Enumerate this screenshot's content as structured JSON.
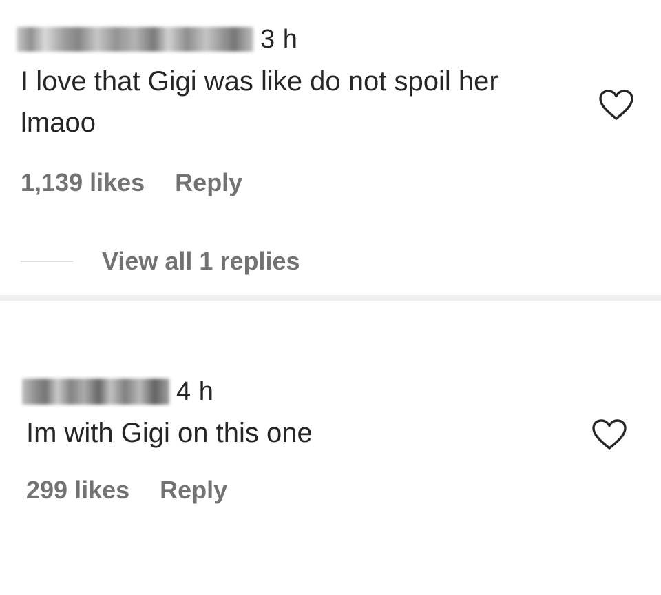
{
  "comments": [
    {
      "username": "",
      "timestamp": "3 h",
      "text": "I love that Gigi was like do not spoil her lmaoo",
      "likes": "1,139 likes",
      "reply_label": "Reply",
      "view_replies_label": "View all 1 replies",
      "like_icon": "heart-outline-icon"
    },
    {
      "username": "",
      "timestamp": "4 h",
      "text": "Im with Gigi on this one",
      "likes": "299 likes",
      "reply_label": "Reply",
      "like_icon": "heart-outline-icon"
    }
  ],
  "colors": {
    "text": "#262626",
    "secondary_text": "#737373",
    "divider": "#efefef",
    "replies_line": "#dbdbdb"
  }
}
